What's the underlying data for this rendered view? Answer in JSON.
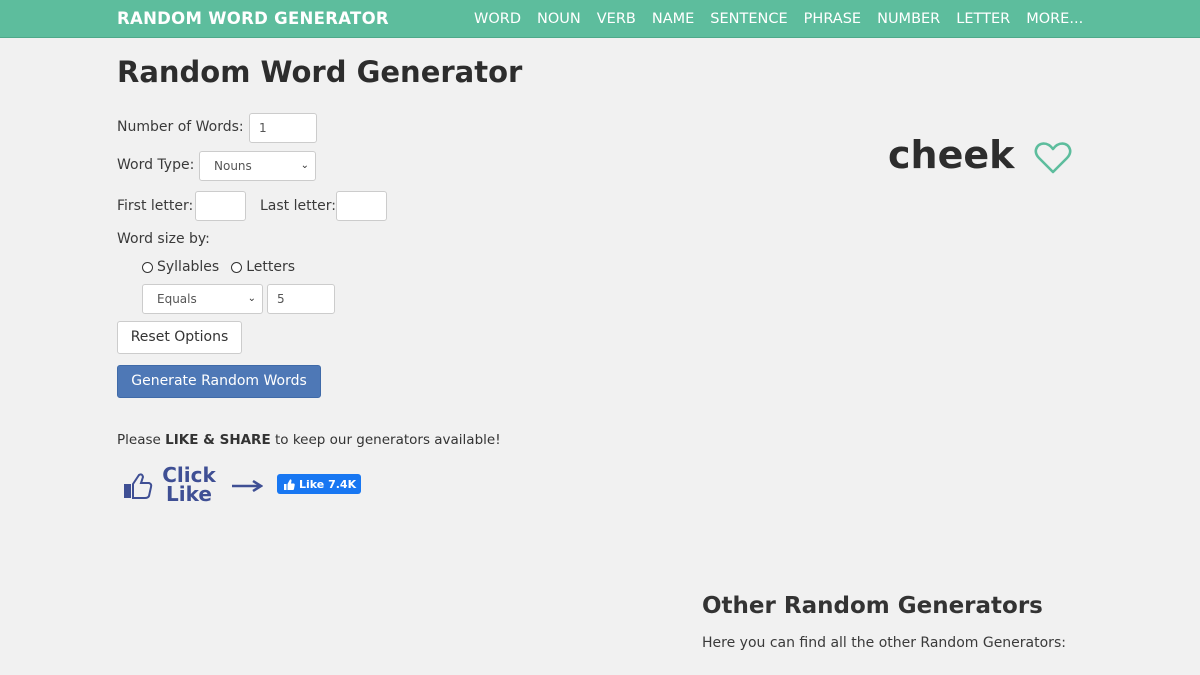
{
  "header": {
    "brand": "RANDOM WORD GENERATOR",
    "nav": [
      "WORD",
      "NOUN",
      "VERB",
      "NAME",
      "SENTENCE",
      "PHRASE",
      "NUMBER",
      "LETTER",
      "MORE..."
    ]
  },
  "main": {
    "title": "Random Word Generator",
    "form": {
      "number_of_words_label": "Number of Words:",
      "number_of_words_value": "1",
      "word_type_label": "Word Type:",
      "word_type_value": "Nouns",
      "first_letter_label": "First letter:",
      "first_letter_value": "",
      "last_letter_label": "Last letter:",
      "last_letter_value": "",
      "word_size_label": "Word size by:",
      "size_options": [
        "Syllables",
        "Letters"
      ],
      "comparison_value": "Equals",
      "size_value": "5",
      "reset_label": "Reset Options",
      "generate_label": "Generate Random Words"
    },
    "share": {
      "prefix": "Please ",
      "bold": "LIKE & SHARE",
      "suffix": " to keep our generators available!",
      "click_line1": "Click",
      "click_line2": "Like",
      "fb_label": "Like 7.4K"
    },
    "result": {
      "word": "cheek"
    },
    "other": {
      "title": "Other Random Generators",
      "subtitle": "Here you can find all the other Random Generators:"
    }
  },
  "colors": {
    "nav_bg": "#5dbd9d",
    "generate_button": "#4e78b6",
    "heart": "#5dbd9d",
    "click_like": "#3f4f94",
    "fb_button": "#1877f2"
  },
  "icons": [
    "thumbs-up-icon",
    "arrow-right-icon",
    "facebook-like-icon",
    "heart-icon",
    "chevron-down-icon",
    "radio-icon"
  ]
}
